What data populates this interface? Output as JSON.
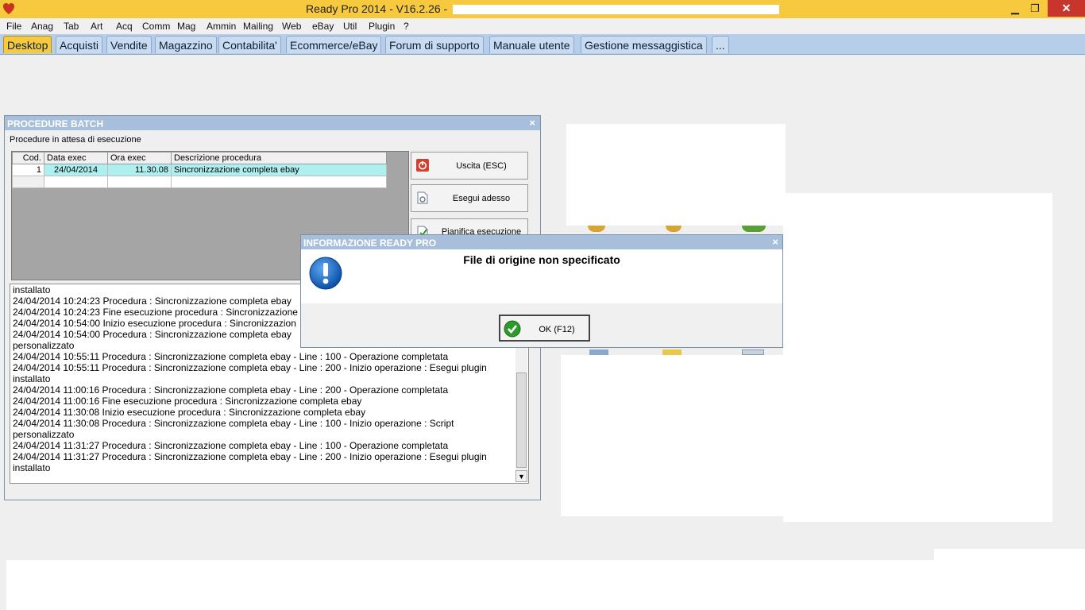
{
  "window": {
    "title": "Ready Pro 2014 - V16.2.26 -",
    "minimize": "▁",
    "restore": "❐",
    "close": "✕"
  },
  "menu": [
    "File",
    "Anag",
    "Tab",
    "Art",
    "Acq",
    "Comm",
    "Mag",
    "Ammin",
    "Mailing",
    "Web",
    "eBay",
    "Util",
    "Plugin",
    "?"
  ],
  "tabs": [
    "Desktop",
    "Acquisti",
    "Vendite",
    "Magazzino",
    "Contabilita'",
    "Ecommerce/eBay",
    "Forum di supporto",
    "Manuale utente",
    "Gestione messaggistica",
    "..."
  ],
  "active_tab": "Desktop",
  "batch": {
    "title": "PROCEDURE BATCH",
    "close": "×",
    "subtitle": "Procedure in attesa di esecuzione",
    "columns": [
      "Cod.",
      "Data exec",
      "Ora exec",
      "Descrizione procedura"
    ],
    "rows": [
      {
        "cod": "1",
        "data": "24/04/2014",
        "ora": "11.30.08",
        "descr": "Sincronizzazione completa ebay"
      }
    ],
    "buttons": {
      "exit": "Uscita (ESC)",
      "run": "Esegui adesso",
      "schedule": "Pianifica esecuzione"
    },
    "log": [
      "installato",
      "24/04/2014 10:24:23 Procedura : Sincronizzazione completa ebay",
      "24/04/2014 10:24:23 Fine esecuzione procedura : Sincronizzazione",
      "24/04/2014 10:54:00 Inizio esecuzione procedura : Sincronizzazion",
      "24/04/2014 10:54:00 Procedura : Sincronizzazione completa ebay",
      "personalizzato",
      "24/04/2014 10:55:11 Procedura : Sincronizzazione completa ebay - Line : 100 - Operazione completata",
      "24/04/2014 10:55:11 Procedura : Sincronizzazione completa ebay - Line : 200 - Inizio operazione : Esegui plugin",
      "installato",
      "24/04/2014 11:00:16 Procedura : Sincronizzazione completa ebay - Line : 200 - Operazione completata",
      "24/04/2014 11:00:16 Fine esecuzione procedura : Sincronizzazione completa ebay",
      "24/04/2014 11:30:08 Inizio esecuzione procedura : Sincronizzazione completa ebay",
      "24/04/2014 11:30:08 Procedura : Sincronizzazione completa ebay - Line : 100 - Inizio operazione : Script",
      "personalizzato",
      "24/04/2014 11:31:27 Procedura : Sincronizzazione completa ebay - Line : 100 - Operazione completata",
      "24/04/2014 11:31:27 Procedura : Sincronizzazione completa ebay - Line : 200 - Inizio operazione : Esegui plugin",
      "installato"
    ],
    "scroll_down": "▼"
  },
  "info_dialog": {
    "title": "INFORMAZIONE READY PRO",
    "close": "×",
    "message": "File di origine non specificato",
    "ok": "OK (F12)"
  },
  "colors": {
    "title_bar": "#f6c93e",
    "tab_bar": "#b7ceea",
    "header": "#a7bfdb",
    "selected_row": "#aef0f0"
  }
}
